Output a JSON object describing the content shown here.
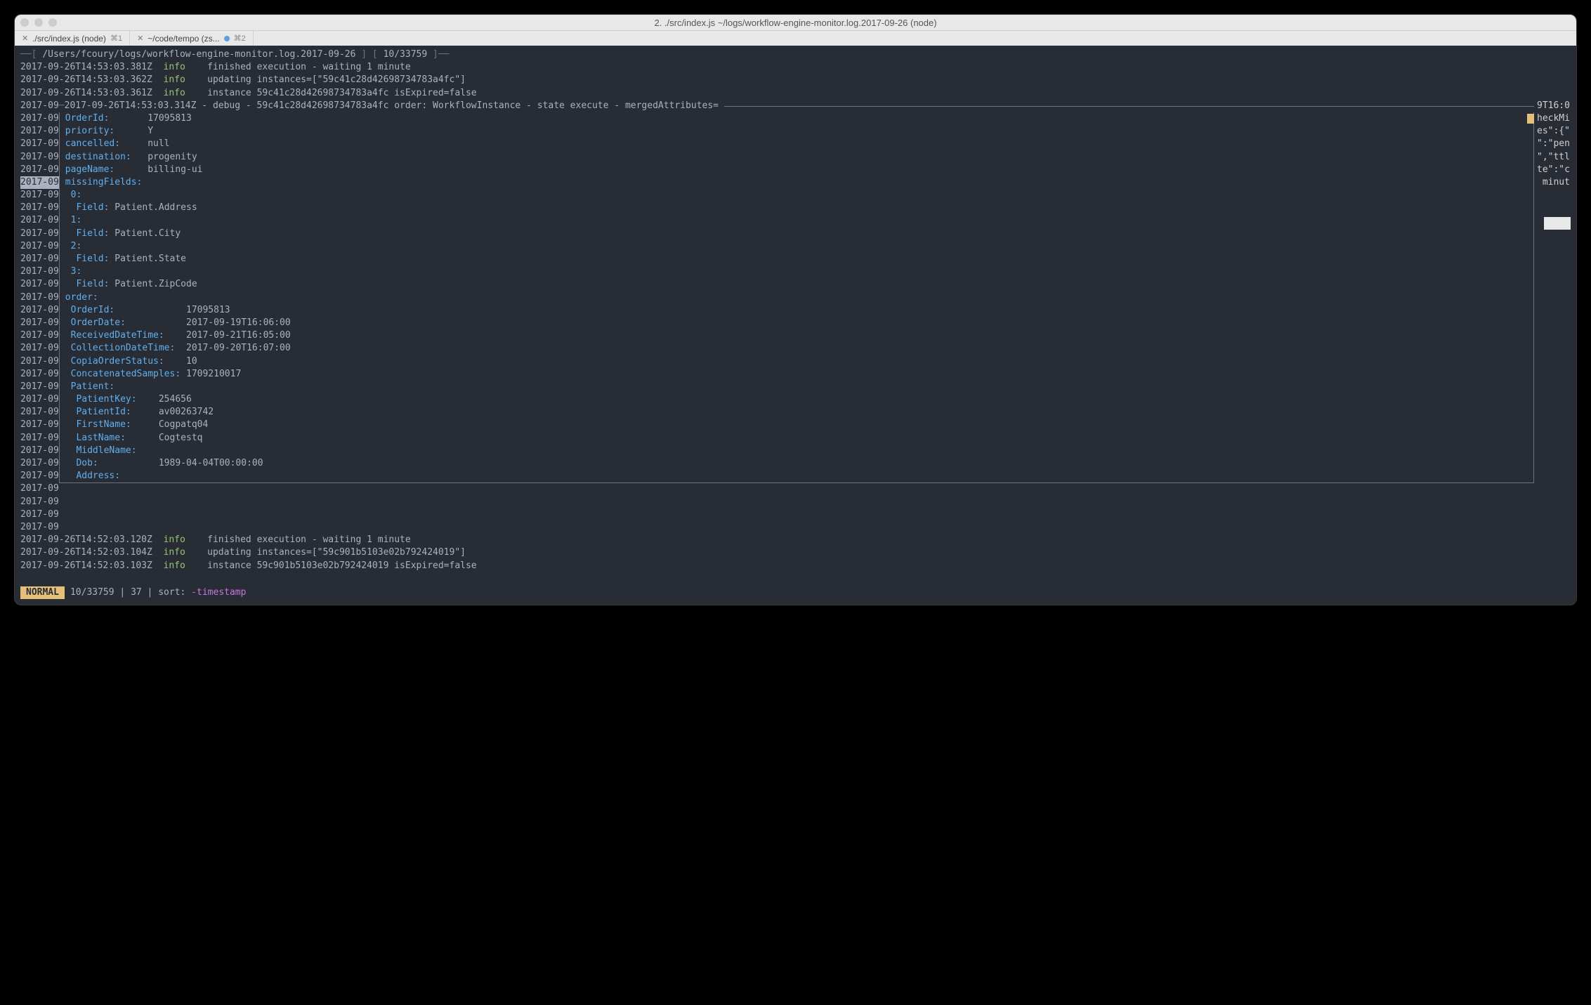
{
  "window": {
    "title": "2. ./src/index.js ~/logs/workflow-engine-monitor.log.2017-09-26 (node)"
  },
  "tabs": [
    {
      "label": "./src/index.js (node)",
      "shortcut": "⌘1",
      "dirty": false
    },
    {
      "label": "~/code/tempo (zs...",
      "shortcut": "⌘2",
      "dirty": true
    }
  ],
  "header": {
    "path": "/Users/fcoury/logs/workflow-engine-monitor.log.2017-09-26",
    "position": "10/33759"
  },
  "top_logs": [
    {
      "ts": "2017-09-26T14:53:03.381Z",
      "level": "info",
      "msg": "finished execution - waiting 1 minute"
    },
    {
      "ts": "2017-09-26T14:53:03.362Z",
      "level": "info",
      "msg": "updating instances=[\"59c41c28d42698734783a4fc\"]"
    },
    {
      "ts": "2017-09-26T14:53:03.361Z",
      "level": "info",
      "msg": "instance 59c41c28d42698734783a4fc isExpired=false"
    }
  ],
  "gutter_prefix": "2017-09",
  "box_header": "2017-09-26T14:53:03.314Z - debug - 59c41c28d42698734783a4fc order: WorkflowInstance - state execute - mergedAttributes=",
  "details_top": [
    {
      "key": "OrderId:",
      "val": "17095813"
    },
    {
      "key": "priority:",
      "val": "Y"
    },
    {
      "key": "cancelled:",
      "val": "null"
    },
    {
      "key": "destination:",
      "val": "progenity"
    },
    {
      "key": "pageName:",
      "val": "billing-ui"
    }
  ],
  "missing_header": "missingFields:",
  "missing_fields": [
    {
      "idx": "0:",
      "field": "Patient.Address"
    },
    {
      "idx": "1:",
      "field": "Patient.City"
    },
    {
      "idx": "2:",
      "field": "Patient.State"
    },
    {
      "idx": "3:",
      "field": "Patient.ZipCode"
    }
  ],
  "order_header": "order:",
  "order_fields": [
    {
      "key": "OrderId:",
      "val": "17095813"
    },
    {
      "key": "OrderDate:",
      "val": "2017-09-19T16:06:00"
    },
    {
      "key": "ReceivedDateTime:",
      "val": "2017-09-21T16:05:00"
    },
    {
      "key": "CollectionDateTime:",
      "val": "2017-09-20T16:07:00"
    },
    {
      "key": "CopiaOrderStatus:",
      "val": "10"
    },
    {
      "key": "ConcatenatedSamples:",
      "val": "1709210017"
    }
  ],
  "patient_header": "Patient:",
  "patient_fields": [
    {
      "key": "PatientKey:",
      "val": "254656"
    },
    {
      "key": "PatientId:",
      "val": "av00263742"
    },
    {
      "key": "FirstName:",
      "val": "Cogpatq04"
    },
    {
      "key": "LastName:",
      "val": "Cogtestq"
    },
    {
      "key": "MiddleName:",
      "val": ""
    },
    {
      "key": "Dob:",
      "val": "1989-04-04T00:00:00"
    },
    {
      "key": "Address:",
      "val": ""
    }
  ],
  "bottom_logs": [
    {
      "ts": "2017-09-26T14:52:03.120Z",
      "level": "info",
      "msg": "finished execution - waiting 1 minute"
    },
    {
      "ts": "2017-09-26T14:52:03.104Z",
      "level": "info",
      "msg": "updating instances=[\"59c901b5103e02b792424019\"]"
    },
    {
      "ts": "2017-09-26T14:52:03.103Z",
      "level": "info",
      "msg": "instance 59c901b5103e02b792424019 isExpired=false"
    }
  ],
  "right_peek": [
    "",
    "",
    "",
    "",
    "",
    "",
    "",
    "",
    "",
    "9T16:0",
    "",
    "",
    "",
    "",
    "",
    "",
    "",
    "",
    "",
    "",
    "",
    "",
    "",
    "",
    "heckMi",
    "",
    "",
    "es\":{\"",
    "\":\"pen",
    "\",\"ttl",
    "te\":\"c",
    " minut",
    "",
    "",
    ""
  ],
  "status": {
    "mode": "NORMAL",
    "position": "10/33759",
    "col": "37",
    "sort_label": "sort:",
    "sort_value": "-timestamp"
  },
  "labels": {
    "field": "Field:"
  }
}
